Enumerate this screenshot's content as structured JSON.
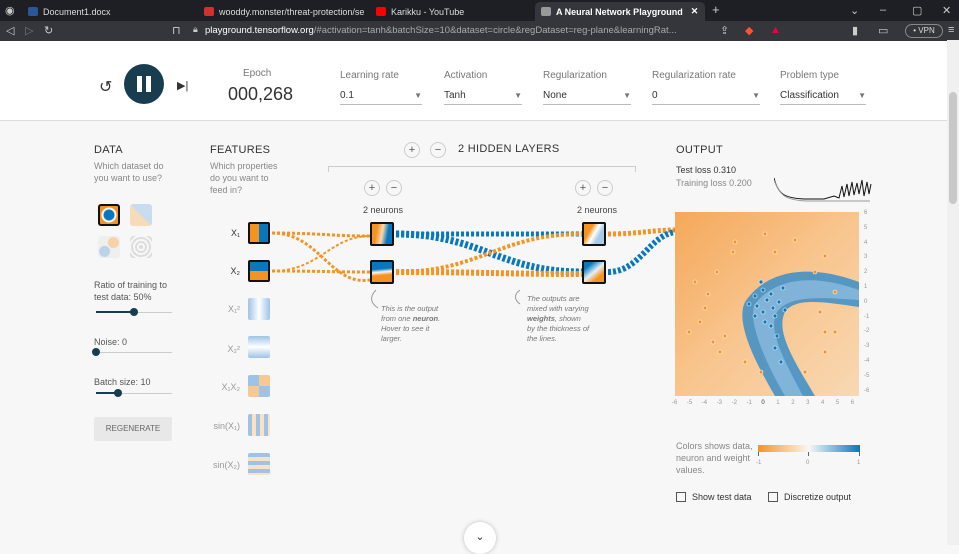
{
  "browser": {
    "tabs": [
      {
        "title": "Document1.docx",
        "color": "#2b579a"
      },
      {
        "title": "wooddy.monster/threat-protection/se",
        "color": "#d0312d"
      },
      {
        "title": "Karikku - YouTube",
        "color": "#ff0000"
      },
      {
        "title": "A Neural Network Playground",
        "color": "#999999"
      }
    ],
    "new_tab": "+",
    "url_host": "playground.tensorflow.org",
    "url_rest": "/#activation=tanh&batchSize=10&dataset=circle&regDataset=reg-plane&learningRat...",
    "vpn_label": "• VPN"
  },
  "controls": {
    "epoch_label": "Epoch",
    "epoch_value": "000,268",
    "learning_rate_label": "Learning rate",
    "learning_rate_value": "0.1",
    "activation_label": "Activation",
    "activation_value": "Tanh",
    "regularization_label": "Regularization",
    "regularization_value": "None",
    "regularization_rate_label": "Regularization rate",
    "regularization_rate_value": "0",
    "problem_type_label": "Problem type",
    "problem_type_value": "Classification"
  },
  "data_panel": {
    "heading": "DATA",
    "question": "Which dataset do you want to use?",
    "ratio_label": "Ratio of training to test data:  50%",
    "ratio_value": 0.5,
    "noise_label": "Noise:  0",
    "noise_value": 0,
    "batch_label": "Batch size:  10",
    "batch_value": 0.3,
    "regenerate": "REGENERATE"
  },
  "features": {
    "heading": "FEATURES",
    "question": "Which properties do you want to feed in?",
    "items": [
      {
        "label": "X₁",
        "active": true
      },
      {
        "label": "X₂",
        "active": true
      },
      {
        "label": "X₁²",
        "active": false
      },
      {
        "label": "X₂²",
        "active": false
      },
      {
        "label": "X₁X₂",
        "active": false
      },
      {
        "label": "sin(X₁)",
        "active": false
      },
      {
        "label": "sin(X₂)",
        "active": false
      }
    ]
  },
  "hidden": {
    "plus": "+",
    "minus": "−",
    "title": "2  HIDDEN LAYERS",
    "layer1_neurons": "2 neurons",
    "layer2_neurons": "2 neurons",
    "note1_a": "This is the output",
    "note1_b": "from one ",
    "note1_bold": "neuron",
    "note1_c": ".",
    "note1_d": "Hover to see it",
    "note1_e": "larger.",
    "note2_a": "The outputs are",
    "note2_b": "mixed with varying",
    "note2_bold": "weights",
    "note2_c": ", shown",
    "note2_d": "by the thickness of",
    "note2_e": "the lines."
  },
  "output": {
    "heading": "OUTPUT",
    "test_loss": "Test loss 0.310",
    "training_loss": "Training loss 0.200",
    "y_ticks": [
      "6",
      "5",
      "4",
      "3",
      "2",
      "1",
      "0",
      "-1",
      "-2",
      "-3",
      "-4",
      "-5",
      "-6"
    ],
    "x_ticks": [
      "-6",
      "-5",
      "-4",
      "-3",
      "-2",
      "-1",
      "0",
      "1",
      "2",
      "3",
      "4",
      "5",
      "6"
    ],
    "legend_text": "Colors shows data, neuron and weight values.",
    "legend_min": "-1",
    "legend_mid": "0",
    "legend_max": "1",
    "show_test": "Show test data",
    "discretize": "Discretize output"
  },
  "colors": {
    "orange": "#f59322",
    "blue": "#0877bd",
    "dark": "#183d4e"
  }
}
